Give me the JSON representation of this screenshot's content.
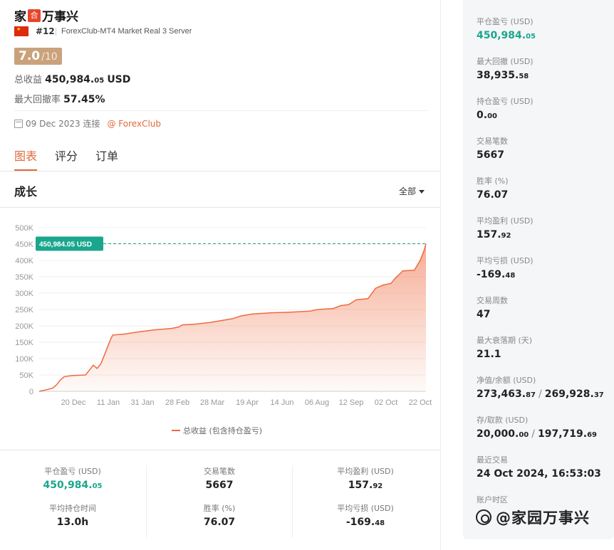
{
  "account": {
    "name_prefix": "家",
    "logo_char": "合",
    "name_suffix": "万事兴",
    "rank": "#12",
    "server": "ForexClub-MT4 Market Real 3 Server",
    "score": "7.0",
    "score_denominator": "/10",
    "total_profit_label": "总收益",
    "total_profit_main": "450,984.",
    "total_profit_dec": "05",
    "total_profit_unit": "USD",
    "max_drawdown_label": "最大回撤率",
    "max_drawdown_value": "57.45%",
    "connected_date": "09 Dec 2023 连接",
    "broker": "@ ForexClub"
  },
  "tabs": [
    {
      "label": "图表",
      "active": true
    },
    {
      "label": "评分",
      "active": false
    },
    {
      "label": "订单",
      "active": false
    }
  ],
  "growth": {
    "title": "成长",
    "range_label": "全部",
    "legend": "总收益 (包含持仓盈亏)"
  },
  "chart_data": {
    "type": "area",
    "y_ticks": [
      "0",
      "50K",
      "100K",
      "150K",
      "200K",
      "250K",
      "300K",
      "350K",
      "400K",
      "450K",
      "500K"
    ],
    "ylim": [
      0,
      500000
    ],
    "x_ticks": [
      "20 Dec",
      "11 Jan",
      "31 Jan",
      "28 Feb",
      "28 Mar",
      "19 Apr",
      "14 Jun",
      "06 Aug",
      "12 Sep",
      "02 Oct",
      "22 Oct"
    ],
    "series": [
      {
        "name": "总收益 (包含持仓盈亏)",
        "color": "#ef6a3e",
        "points": [
          [
            0,
            0
          ],
          [
            0.02,
            5000
          ],
          [
            0.035,
            10000
          ],
          [
            0.045,
            20000
          ],
          [
            0.055,
            35000
          ],
          [
            0.065,
            45000
          ],
          [
            0.085,
            48000
          ],
          [
            0.12,
            50000
          ],
          [
            0.13,
            65000
          ],
          [
            0.14,
            80000
          ],
          [
            0.15,
            70000
          ],
          [
            0.16,
            85000
          ],
          [
            0.175,
            130000
          ],
          [
            0.185,
            160000
          ],
          [
            0.19,
            172000
          ],
          [
            0.22,
            175000
          ],
          [
            0.26,
            182000
          ],
          [
            0.3,
            188000
          ],
          [
            0.34,
            192000
          ],
          [
            0.36,
            196000
          ],
          [
            0.37,
            203000
          ],
          [
            0.4,
            205000
          ],
          [
            0.44,
            210000
          ],
          [
            0.47,
            216000
          ],
          [
            0.5,
            222000
          ],
          [
            0.52,
            230000
          ],
          [
            0.55,
            236000
          ],
          [
            0.6,
            240000
          ],
          [
            0.65,
            242000
          ],
          [
            0.7,
            245000
          ],
          [
            0.72,
            250000
          ],
          [
            0.76,
            253000
          ],
          [
            0.78,
            262000
          ],
          [
            0.8,
            265000
          ],
          [
            0.82,
            280000
          ],
          [
            0.85,
            283000
          ],
          [
            0.87,
            315000
          ],
          [
            0.89,
            325000
          ],
          [
            0.91,
            330000
          ],
          [
            0.92,
            345000
          ],
          [
            0.935,
            362000
          ],
          [
            0.94,
            368000
          ],
          [
            0.97,
            370000
          ],
          [
            0.985,
            400000
          ],
          [
            0.995,
            430000
          ],
          [
            1.0,
            450984
          ]
        ]
      }
    ],
    "marker_label": "450,984.05 USD",
    "marker_value": 450984.05,
    "grid": true
  },
  "bottom_stats": [
    {
      "label": "平仓盈亏 (USD)",
      "main": "450,984.",
      "dec": "05",
      "green": true
    },
    {
      "label": "交易笔数",
      "main": "5667",
      "dec": "",
      "green": false
    },
    {
      "label": "平均盈利 (USD)",
      "main": "157.",
      "dec": "92",
      "green": false
    },
    {
      "label": "平均持仓时间",
      "main": "13.0h",
      "dec": "",
      "green": false
    },
    {
      "label": "胜率 (%)",
      "main": "76.07",
      "dec": "",
      "green": false
    },
    {
      "label": "平均亏损 (USD)",
      "main": "-169.",
      "dec": "48",
      "green": false
    }
  ],
  "side_stats": [
    {
      "label": "平仓盈亏 (USD)",
      "main": "450,984.",
      "dec": "05",
      "green": true
    },
    {
      "label": "最大回撤 (USD)",
      "main": "38,935.",
      "dec": "58"
    },
    {
      "label": "持仓盈亏 (USD)",
      "main": "0.",
      "dec": "00"
    },
    {
      "label": "交易笔数",
      "main": "5667",
      "dec": ""
    },
    {
      "label": "胜率 (%)",
      "main": "76.07",
      "dec": ""
    },
    {
      "label": "平均盈利 (USD)",
      "main": "157.",
      "dec": "92"
    },
    {
      "label": "平均亏损 (USD)",
      "main": "-169.",
      "dec": "48"
    },
    {
      "label": "交易周数",
      "main": "47",
      "dec": ""
    },
    {
      "label": "最大衰落期 (天)",
      "main": "21.1",
      "dec": ""
    },
    {
      "label": "净值/余额 (USD)",
      "main": "273,463.",
      "dec": "87",
      "main2": "269,928.",
      "dec2": "37"
    },
    {
      "label": "存/取款 (USD)",
      "main": "20,000.",
      "dec": "00",
      "main2": "197,719.",
      "dec2": "69"
    },
    {
      "label": "最近交易",
      "main": "24 Oct 2024, 16:53:03",
      "dec": ""
    },
    {
      "label": "账户时区",
      "main": "",
      "dec": ""
    }
  ],
  "watermark": "@家园万事兴",
  "colors": {
    "accent": "#e06a3a",
    "green": "#1aa68d",
    "chart_line": "#ef6a3e",
    "score_bg": "#c9a27c"
  }
}
